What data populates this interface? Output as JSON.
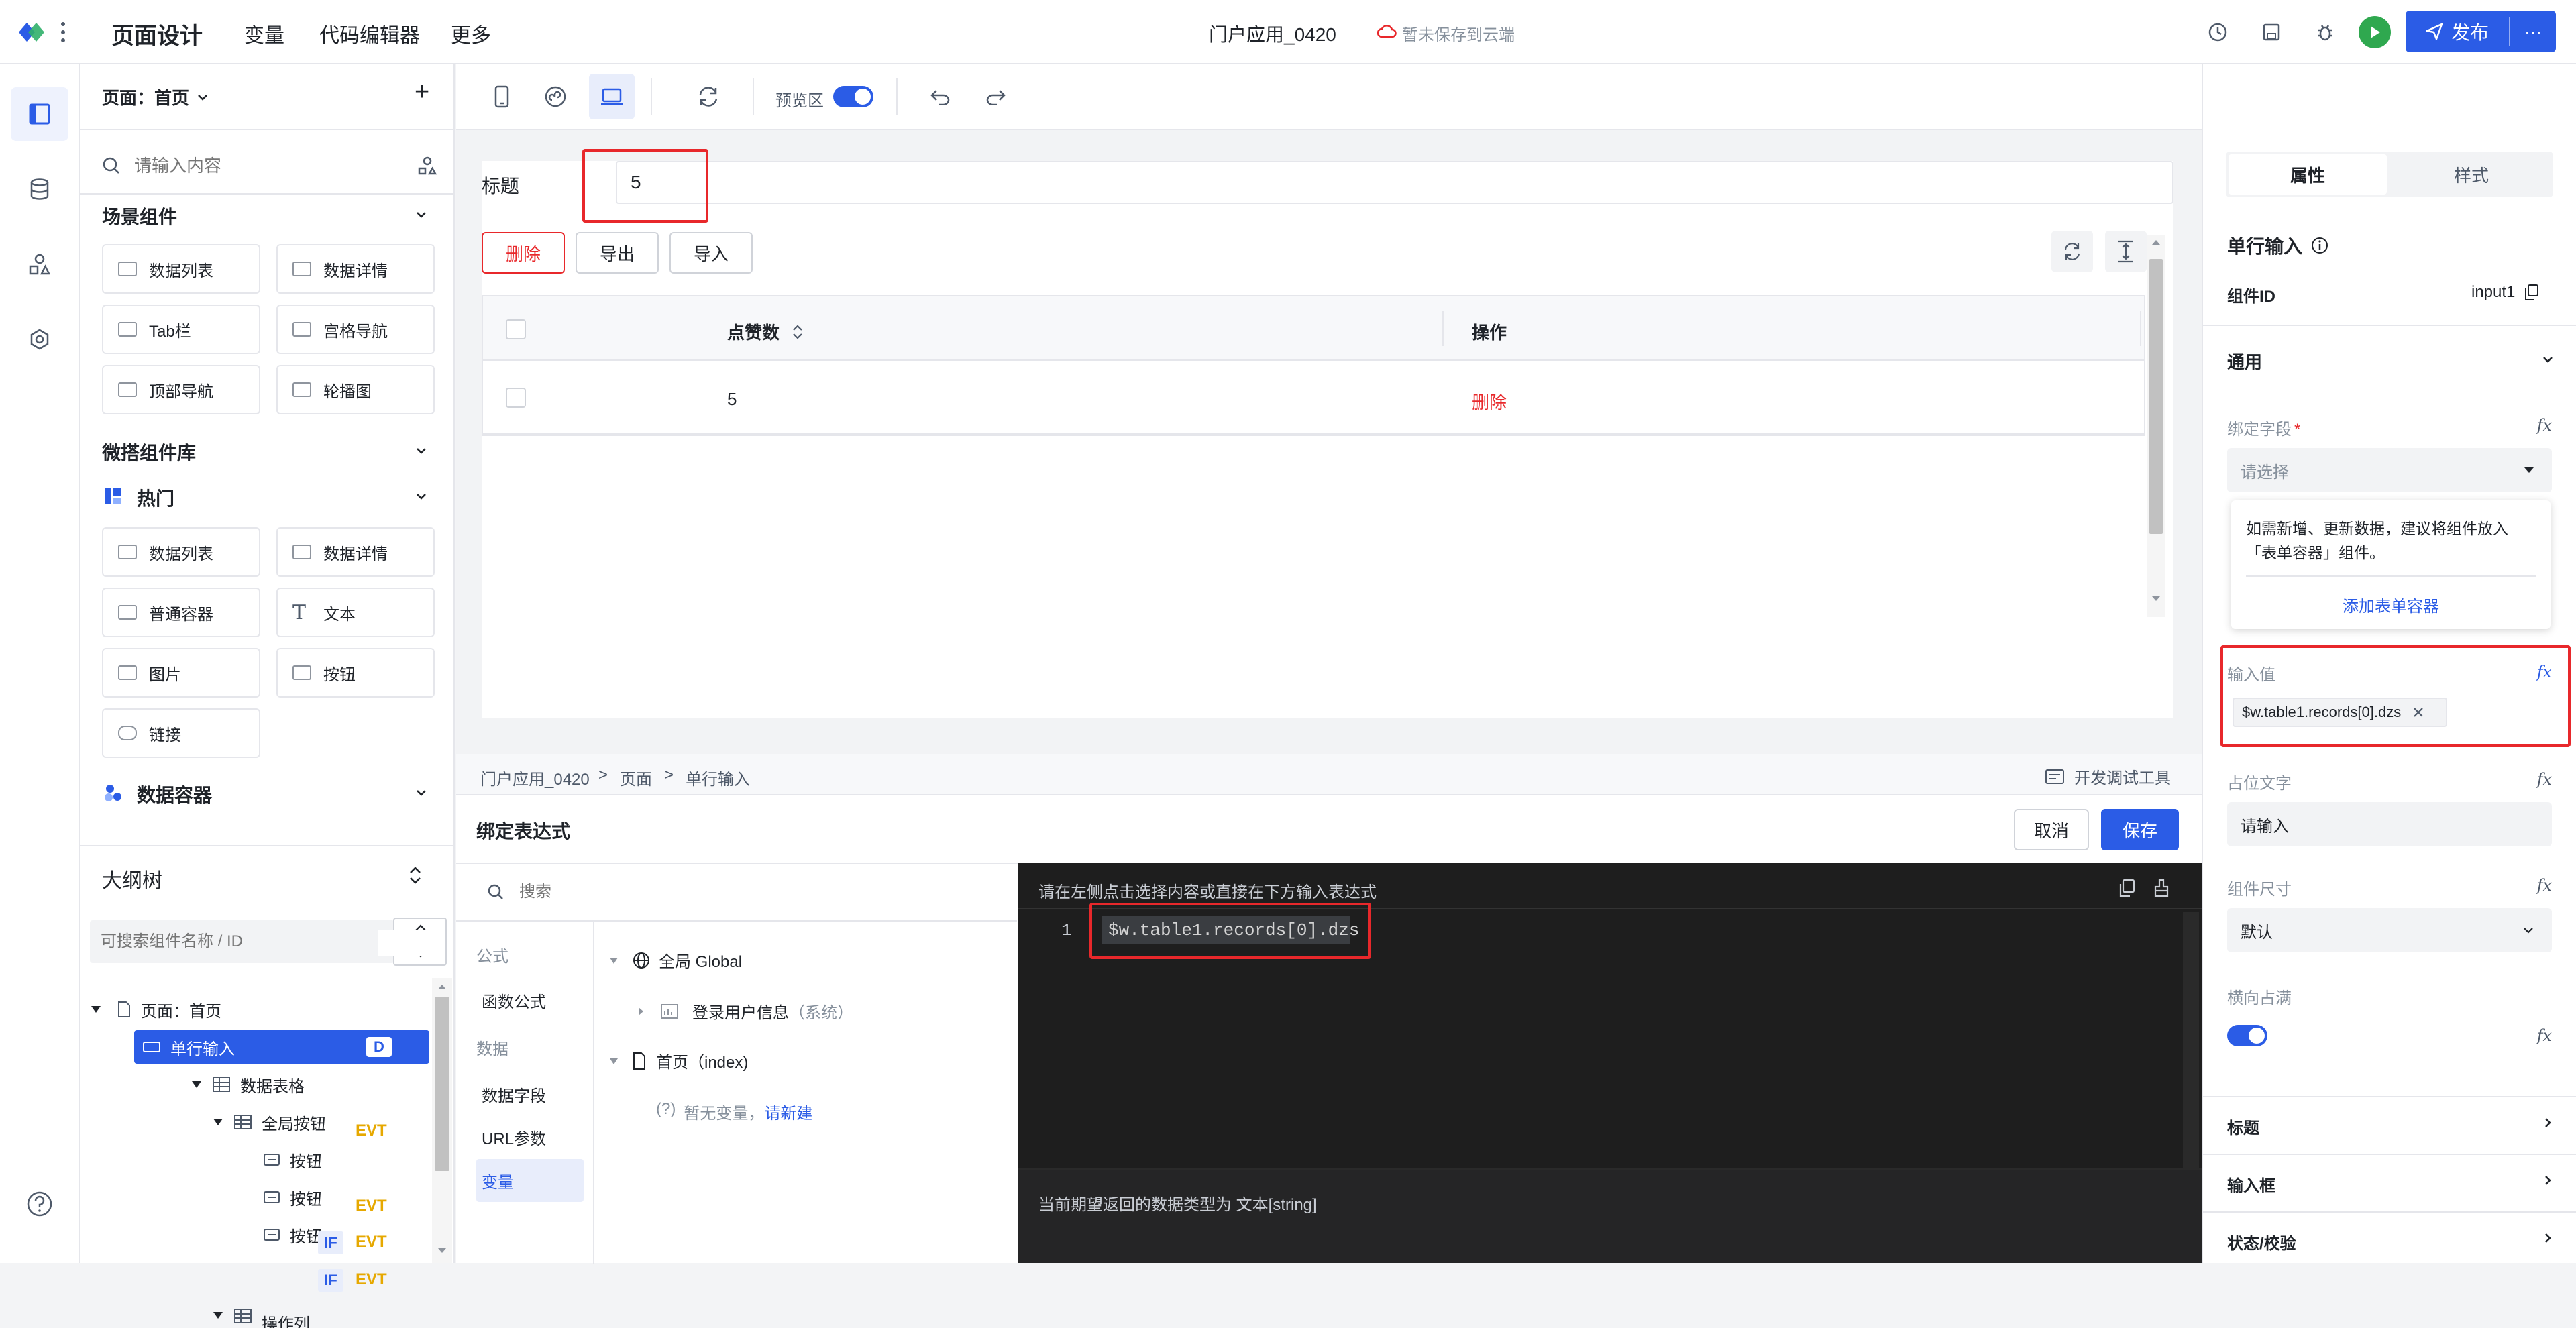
{
  "topbar": {
    "title": "页面设计",
    "nav": [
      "变量",
      "代码编辑器",
      "更多"
    ],
    "app_name": "门户应用_0420",
    "save_status": "暂未保存到云端",
    "publish_label": "发布",
    "more_label": "···"
  },
  "components": {
    "page_selector": "页面：首页",
    "add_label": "+",
    "search_placeholder": "请输入内容",
    "scene_section": "场景组件",
    "scene_items": [
      "数据列表",
      "数据详情",
      "Tab栏",
      "宫格导航",
      "顶部导航",
      "轮播图"
    ],
    "lib_section": "微搭组件库",
    "hot_section": "热门",
    "hot_items": [
      "数据列表",
      "数据详情",
      "普通容器",
      "文本",
      "图片",
      "按钮",
      "链接"
    ],
    "container_section": "数据容器"
  },
  "outline": {
    "title": "大纲树",
    "search_placeholder": "可搜索组件名称 / ID",
    "nodes": [
      {
        "label": "页面：首页",
        "badges": []
      },
      {
        "label": "单行输入",
        "badges": [
          "D"
        ]
      },
      {
        "label": "数据表格",
        "badges": [
          "EVT"
        ]
      },
      {
        "label": "全局按钮",
        "badges": []
      },
      {
        "label": "按钮",
        "badges": [
          "EVT"
        ]
      },
      {
        "label": "按钮",
        "badges": [
          "IF",
          "EVT"
        ]
      },
      {
        "label": "按钮",
        "badges": [
          "IF",
          "EVT"
        ]
      },
      {
        "label": "操作列",
        "badges": []
      }
    ]
  },
  "toolbar": {
    "preview_label": "预览区",
    "preview_on": true
  },
  "canvas": {
    "title_label": "标题",
    "title_value": "5",
    "buttons": [
      "删除",
      "导出",
      "导入"
    ],
    "table": {
      "columns": [
        "点赞数",
        "操作"
      ],
      "rows": [
        {
          "likes": "5",
          "action": "删除"
        }
      ]
    }
  },
  "breadcrumb": {
    "items": [
      "门户应用_0420",
      "页面",
      "单行输入"
    ],
    "separator": ">",
    "dev_tools": "开发调试工具"
  },
  "bind": {
    "title": "绑定表达式",
    "cancel_label": "取消",
    "save_label": "保存",
    "search_placeholder": "搜索",
    "categories": [
      "公式",
      "函数公式",
      "数据",
      "数据字段",
      "URL参数",
      "变量"
    ],
    "tree": {
      "global": "全局 Global",
      "user_info": "登录用户信息",
      "user_info_note": "（系统）",
      "page": "首页（index)",
      "empty_hint": "暂无变量，",
      "create_link": "请新建",
      "help_mark": "(?)"
    },
    "editor_hint": "请在左侧点击选择内容或直接在下方输入表达式",
    "line_number": "1",
    "expression": "$w.table1.records[0].dzs",
    "return_type": "当前期望返回的数据类型为 文本[string]"
  },
  "props": {
    "tabs": [
      "属性",
      "样式"
    ],
    "component_name": "单行输入",
    "id_label": "组件ID",
    "id_value": "input1",
    "group_general": "通用",
    "bind_field_label": "绑定字段",
    "required_mark": "*",
    "bind_field_placeholder": "请选择",
    "tip_text": "如需新增、更新数据，建议将组件放入「表单容器」组件。",
    "tip_link": "添加表单容器",
    "input_value_label": "输入值",
    "input_value_tag": "$w.table1.records[0].dzs",
    "placeholder_label": "占位文字",
    "placeholder_value": "请输入",
    "size_label": "组件尺寸",
    "size_value": "默认",
    "fill_label": "横向占满",
    "fill_on": true,
    "fx_label": "fx",
    "group_title": "标题",
    "group_input": "输入框",
    "group_status": "状态/校验"
  },
  "colors": {
    "primary": "#2b5ce6",
    "danger": "#e8282b",
    "warning": "#e6a800",
    "run_green": "#2fa84f"
  }
}
